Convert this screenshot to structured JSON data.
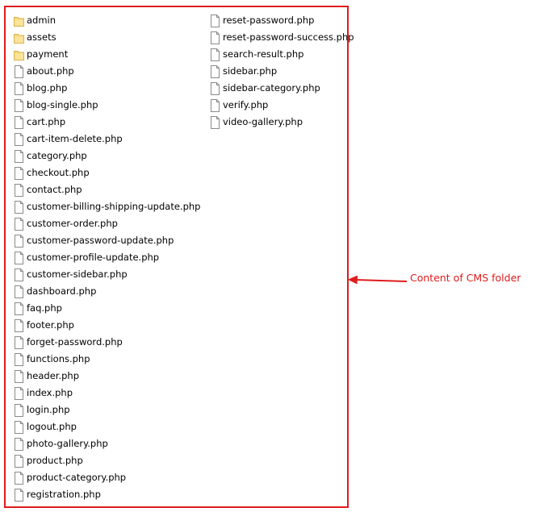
{
  "annotation": {
    "label": "Content of CMS folder",
    "color": "#e01b1b"
  },
  "columns": [
    {
      "items": [
        {
          "name": "admin",
          "icon": "folder-icon"
        },
        {
          "name": "assets",
          "icon": "folder-icon"
        },
        {
          "name": "payment",
          "icon": "folder-icon"
        },
        {
          "name": "about.php",
          "icon": "file-icon"
        },
        {
          "name": "blog.php",
          "icon": "file-icon"
        },
        {
          "name": "blog-single.php",
          "icon": "file-icon"
        },
        {
          "name": "cart.php",
          "icon": "file-icon"
        },
        {
          "name": "cart-item-delete.php",
          "icon": "file-icon"
        },
        {
          "name": "category.php",
          "icon": "file-icon"
        },
        {
          "name": "checkout.php",
          "icon": "file-icon"
        },
        {
          "name": "contact.php",
          "icon": "file-icon"
        },
        {
          "name": "customer-billing-shipping-update.php",
          "icon": "file-icon"
        },
        {
          "name": "customer-order.php",
          "icon": "file-icon"
        },
        {
          "name": "customer-password-update.php",
          "icon": "file-icon"
        },
        {
          "name": "customer-profile-update.php",
          "icon": "file-icon"
        },
        {
          "name": "customer-sidebar.php",
          "icon": "file-icon"
        },
        {
          "name": "dashboard.php",
          "icon": "file-icon"
        },
        {
          "name": "faq.php",
          "icon": "file-icon"
        },
        {
          "name": "footer.php",
          "icon": "file-icon"
        },
        {
          "name": "forget-password.php",
          "icon": "file-icon"
        },
        {
          "name": "functions.php",
          "icon": "file-icon"
        },
        {
          "name": "header.php",
          "icon": "file-icon"
        },
        {
          "name": "index.php",
          "icon": "file-icon"
        },
        {
          "name": "login.php",
          "icon": "file-icon"
        },
        {
          "name": "logout.php",
          "icon": "file-icon"
        },
        {
          "name": "photo-gallery.php",
          "icon": "file-icon"
        },
        {
          "name": "product.php",
          "icon": "file-icon"
        },
        {
          "name": "product-category.php",
          "icon": "file-icon"
        },
        {
          "name": "registration.php",
          "icon": "file-icon"
        }
      ]
    },
    {
      "items": [
        {
          "name": "reset-password.php",
          "icon": "file-icon"
        },
        {
          "name": "reset-password-success.php",
          "icon": "file-icon"
        },
        {
          "name": "search-result.php",
          "icon": "file-icon"
        },
        {
          "name": "sidebar.php",
          "icon": "file-icon"
        },
        {
          "name": "sidebar-category.php",
          "icon": "file-icon"
        },
        {
          "name": "verify.php",
          "icon": "file-icon"
        },
        {
          "name": "video-gallery.php",
          "icon": "file-icon"
        }
      ]
    }
  ]
}
